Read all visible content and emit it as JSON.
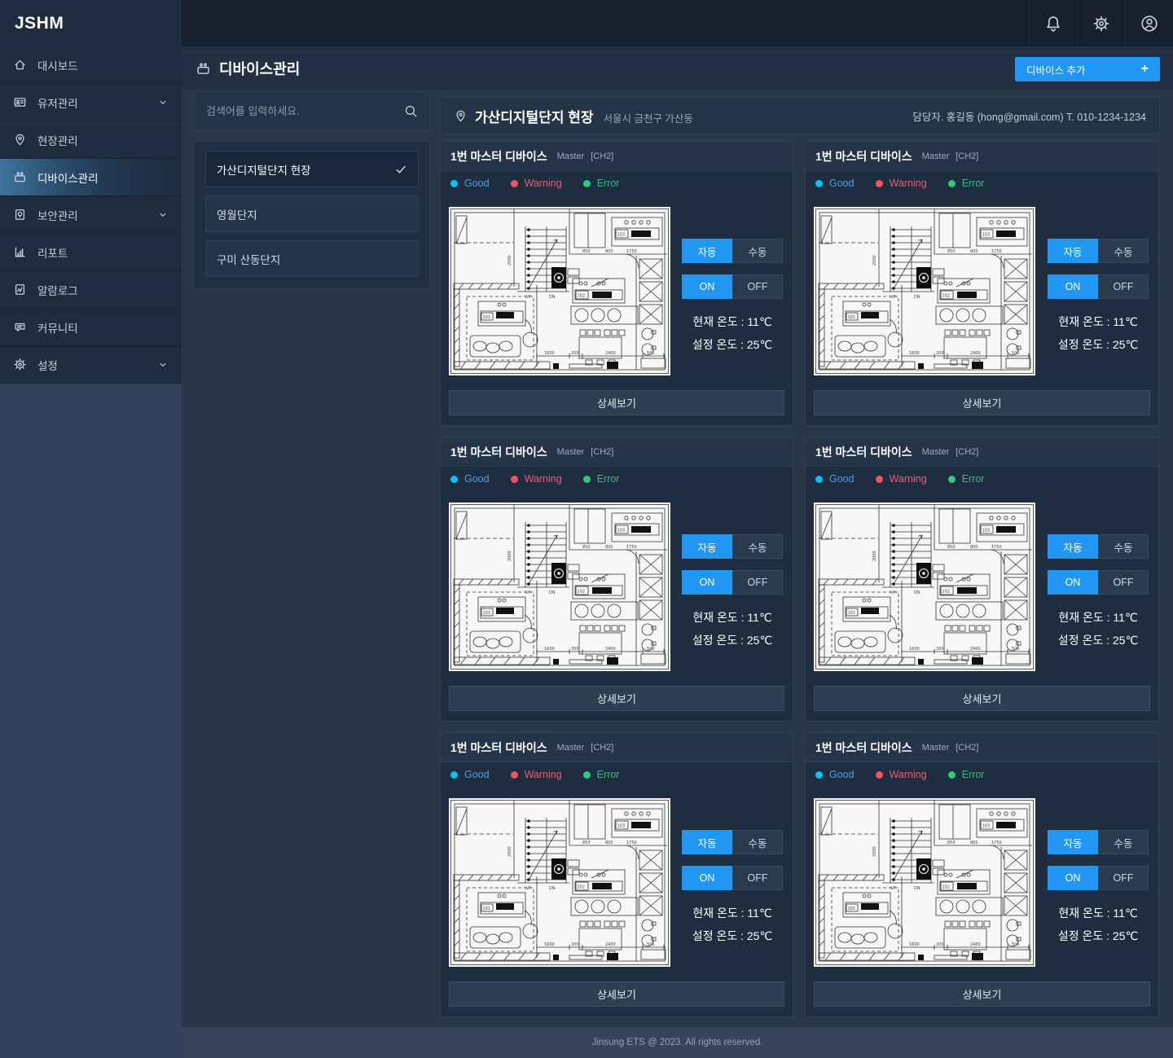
{
  "brand": "JSHM",
  "topbar": {
    "icons": [
      "bell-icon",
      "gear-icon",
      "profile-icon"
    ]
  },
  "sidebar": {
    "items": [
      {
        "label": "대시보드",
        "icon": "home",
        "active": false,
        "expandable": false
      },
      {
        "label": "유저관리",
        "icon": "user",
        "active": false,
        "expandable": true
      },
      {
        "label": "현장관리",
        "icon": "pin",
        "active": false,
        "expandable": false
      },
      {
        "label": "디바이스관리",
        "icon": "device",
        "active": true,
        "expandable": false
      },
      {
        "label": "보안관리",
        "icon": "security",
        "active": false,
        "expandable": true
      },
      {
        "label": "리포트",
        "icon": "report",
        "active": false,
        "expandable": false
      },
      {
        "label": "알람로그",
        "icon": "log",
        "active": false,
        "expandable": false
      },
      {
        "label": "커뮤니티",
        "icon": "chat",
        "active": false,
        "expandable": false
      },
      {
        "label": "설정",
        "icon": "gear",
        "active": false,
        "expandable": true
      }
    ]
  },
  "page": {
    "title": "디바이스관리",
    "add_button": {
      "label": "디바이스 추가",
      "plus": "+"
    }
  },
  "search": {
    "placeholder": "검색어를 입력하세요."
  },
  "sites": [
    {
      "name": "가산디지털단지 현장",
      "selected": true
    },
    {
      "name": "영월단지",
      "selected": false
    },
    {
      "name": "구미 산동단지",
      "selected": false
    }
  ],
  "site_header": {
    "title": "가산디지털단지 현장",
    "address": "서울시 금천구 가산동",
    "contact": "담당자. 홍길동 (hong@gmail.com)  T. 010-1234-1234"
  },
  "legend": {
    "good": "Good",
    "warning": "Warning",
    "error": "Error"
  },
  "cards": [
    {
      "title": "1번 마스터 디바이스",
      "type": "Master",
      "channel": "[CH2]",
      "mode_auto": "자동",
      "mode_manual": "수동",
      "power_on": "ON",
      "power_off": "OFF",
      "current_temp": "현재 온도 : 11℃",
      "set_temp": "설정 온도 : 25℃",
      "detail_label": "상세보기"
    },
    {
      "title": "1번 마스터 디바이스",
      "type": "Master",
      "channel": "[CH2]",
      "mode_auto": "자동",
      "mode_manual": "수동",
      "power_on": "ON",
      "power_off": "OFF",
      "current_temp": "현재 온도 : 11℃",
      "set_temp": "설정 온도 : 25℃",
      "detail_label": "상세보기"
    },
    {
      "title": "1번 마스터 디바이스",
      "type": "Master",
      "channel": "[CH2]",
      "mode_auto": "자동",
      "mode_manual": "수동",
      "power_on": "ON",
      "power_off": "OFF",
      "current_temp": "현재 온도 : 11℃",
      "set_temp": "설정 온도 : 25℃",
      "detail_label": "상세보기"
    },
    {
      "title": "1번 마스터 디바이스",
      "type": "Master",
      "channel": "[CH2]",
      "mode_auto": "자동",
      "mode_manual": "수동",
      "power_on": "ON",
      "power_off": "OFF",
      "current_temp": "현재 온도 : 11℃",
      "set_temp": "설정 온도 : 25℃",
      "detail_label": "상세보기"
    },
    {
      "title": "1번 마스터 디바이스",
      "type": "Master",
      "channel": "[CH2]",
      "mode_auto": "자동",
      "mode_manual": "수동",
      "power_on": "ON",
      "power_off": "OFF",
      "current_temp": "현재 온도 : 11℃",
      "set_temp": "설정 온도 : 25℃",
      "detail_label": "상세보기"
    },
    {
      "title": "1번 마스터 디바이스",
      "type": "Master",
      "channel": "[CH2]",
      "mode_auto": "자동",
      "mode_manual": "수동",
      "power_on": "ON",
      "power_off": "OFF",
      "current_temp": "현재 온도 : 11℃",
      "set_temp": "설정 온도 : 25℃",
      "detail_label": "상세보기"
    }
  ],
  "footer": {
    "text": "Jinsung ETS @ 2023. All rights reserved."
  },
  "colors": {
    "accent": "#2196F3",
    "good": "#00C4F5",
    "warning": "#EF5361",
    "error": "#2FC97E",
    "sidebar": "#1E2C3F",
    "card": "#1E2D3F"
  }
}
